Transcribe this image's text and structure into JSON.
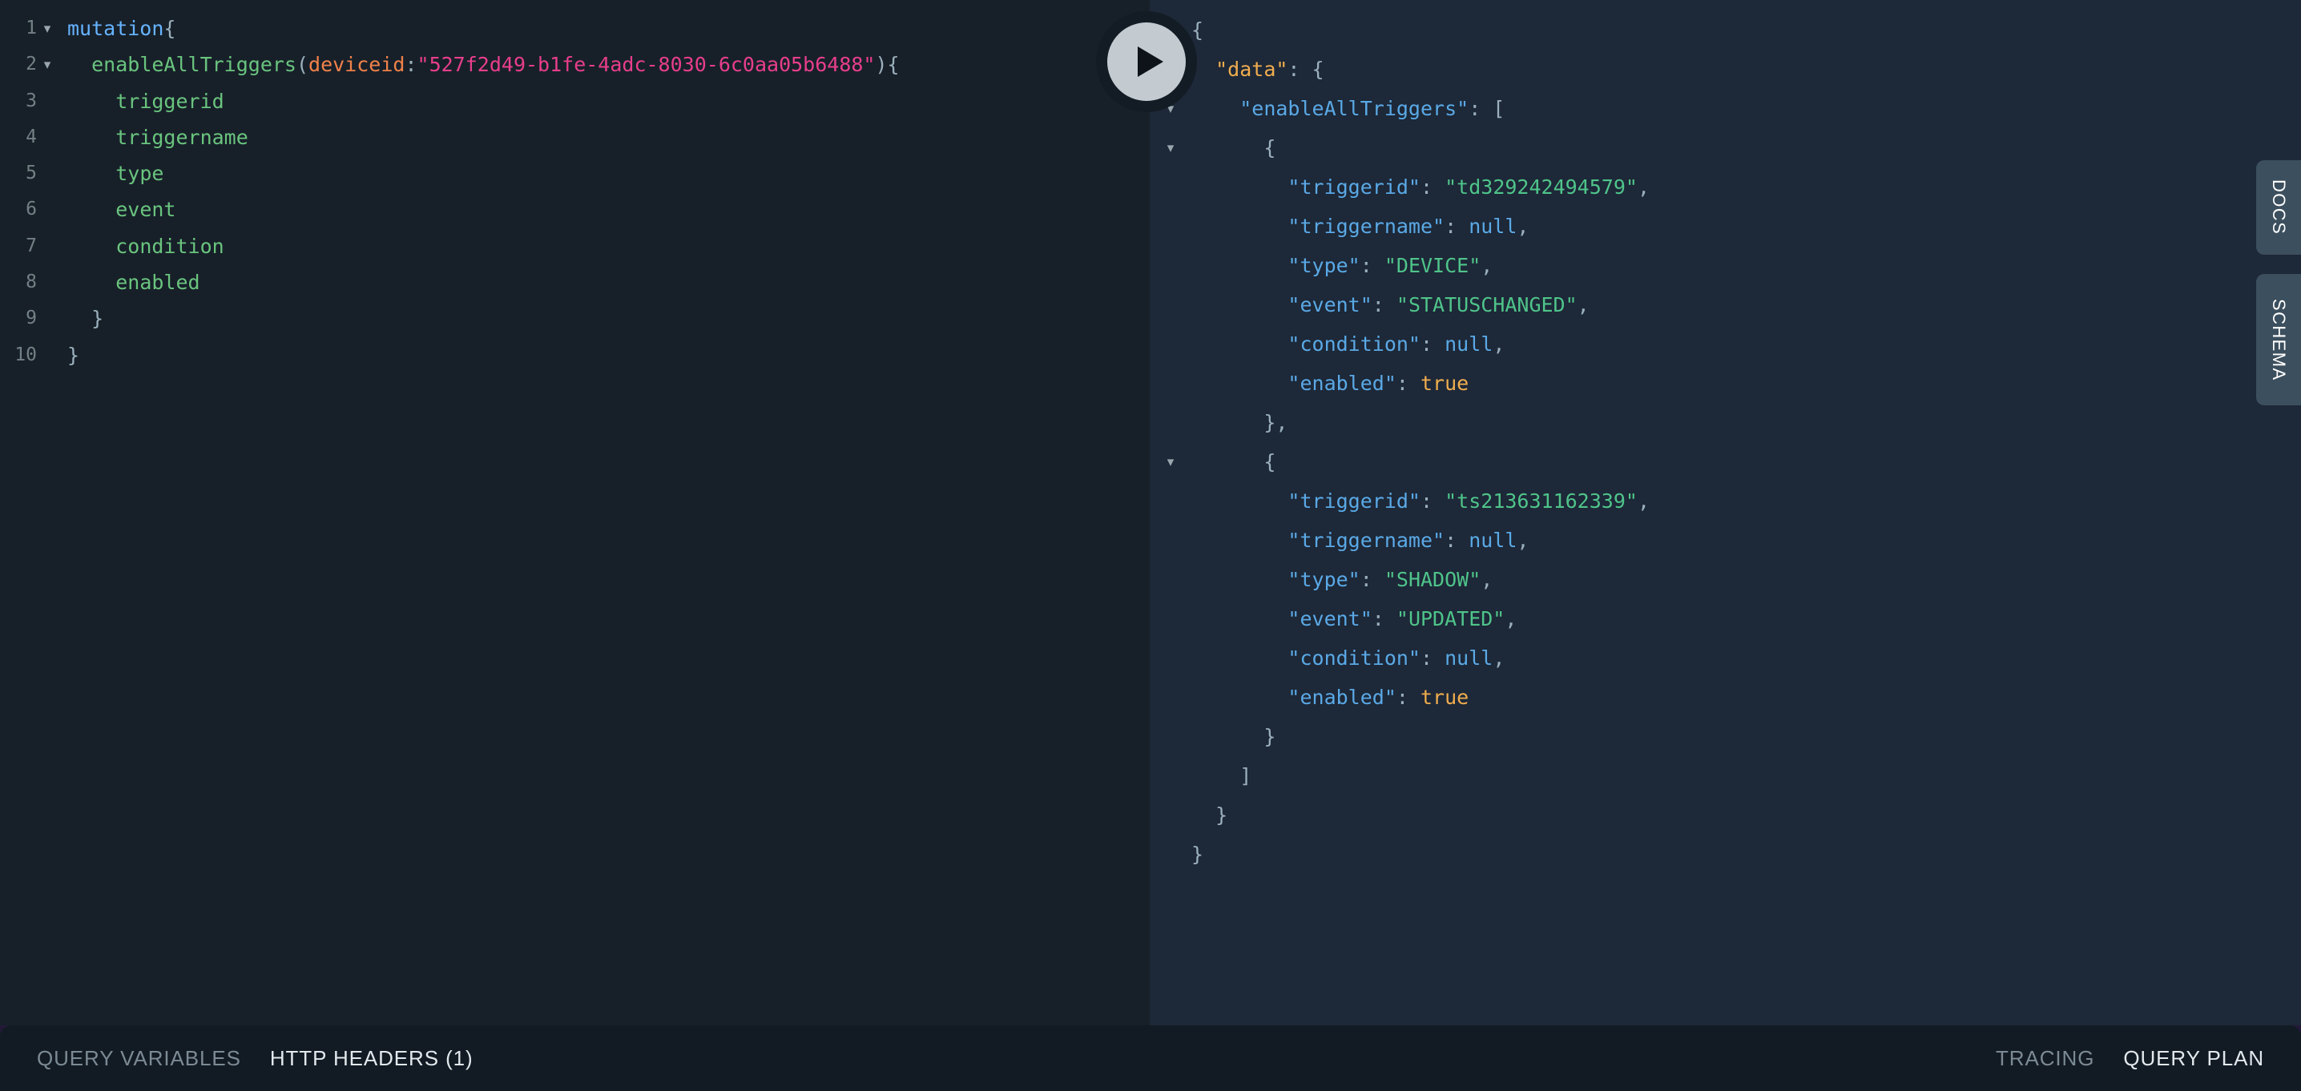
{
  "editor": {
    "device_id": "527f2d49-b1fe-4adc-8030-6c0aa05b6488",
    "lines": [
      {
        "num": "1",
        "fold": "▾",
        "html": "kw:mutation|punct:{"
      },
      {
        "num": "2",
        "fold": "▾",
        "html": "sp:2|field:enableAllTriggers|punct:(|arg:deviceid|punct::|str:\"527f2d49-b1fe-4adc-8030-6c0aa05b6488\"|punct:)|punct:{"
      },
      {
        "num": "3",
        "fold": "",
        "html": "sp:4|field:triggerid"
      },
      {
        "num": "4",
        "fold": "",
        "html": "sp:4|field:triggername"
      },
      {
        "num": "5",
        "fold": "",
        "html": "sp:4|field:type"
      },
      {
        "num": "6",
        "fold": "",
        "html": "sp:4|field:event"
      },
      {
        "num": "7",
        "fold": "",
        "html": "sp:4|field:condition"
      },
      {
        "num": "8",
        "fold": "",
        "html": "sp:4|field:enabled"
      },
      {
        "num": "9",
        "fold": "",
        "html": "sp:2|punct:}"
      },
      {
        "num": "10",
        "fold": "",
        "html": "punct:}"
      }
    ],
    "text": "mutation{\n  enableAllTriggers(deviceid:\"527f2d49-b1fe-4adc-8030-6c0aa05b6488\"){\n    triggerid\n    triggername\n    type\n    event\n    condition\n    enabled\n  }\n}"
  },
  "result": {
    "rows": [
      {
        "fold": "▾",
        "indent": 0,
        "tokens": [
          {
            "t": "punct",
            "v": "{"
          }
        ]
      },
      {
        "fold": "▾",
        "indent": 1,
        "tokens": [
          {
            "t": "key-d",
            "v": "\"data\""
          },
          {
            "t": "punct",
            "v": ": {"
          }
        ]
      },
      {
        "fold": "▾",
        "indent": 2,
        "tokens": [
          {
            "t": "key",
            "v": "\"enableAllTriggers\""
          },
          {
            "t": "punct",
            "v": ": ["
          }
        ]
      },
      {
        "fold": "▾",
        "indent": 3,
        "tokens": [
          {
            "t": "punct",
            "v": "{"
          }
        ]
      },
      {
        "fold": "",
        "indent": 4,
        "tokens": [
          {
            "t": "key",
            "v": "\"triggerid\""
          },
          {
            "t": "punct",
            "v": ": "
          },
          {
            "t": "str",
            "v": "\"td329242494579\""
          },
          {
            "t": "punct",
            "v": ","
          }
        ]
      },
      {
        "fold": "",
        "indent": 4,
        "tokens": [
          {
            "t": "key",
            "v": "\"triggername\""
          },
          {
            "t": "punct",
            "v": ": "
          },
          {
            "t": "null",
            "v": "null"
          },
          {
            "t": "punct",
            "v": ","
          }
        ]
      },
      {
        "fold": "",
        "indent": 4,
        "tokens": [
          {
            "t": "key",
            "v": "\"type\""
          },
          {
            "t": "punct",
            "v": ": "
          },
          {
            "t": "str",
            "v": "\"DEVICE\""
          },
          {
            "t": "punct",
            "v": ","
          }
        ]
      },
      {
        "fold": "",
        "indent": 4,
        "tokens": [
          {
            "t": "key",
            "v": "\"event\""
          },
          {
            "t": "punct",
            "v": ": "
          },
          {
            "t": "str",
            "v": "\"STATUSCHANGED\""
          },
          {
            "t": "punct",
            "v": ","
          }
        ]
      },
      {
        "fold": "",
        "indent": 4,
        "tokens": [
          {
            "t": "key",
            "v": "\"condition\""
          },
          {
            "t": "punct",
            "v": ": "
          },
          {
            "t": "null",
            "v": "null"
          },
          {
            "t": "punct",
            "v": ","
          }
        ]
      },
      {
        "fold": "",
        "indent": 4,
        "tokens": [
          {
            "t": "key",
            "v": "\"enabled\""
          },
          {
            "t": "punct",
            "v": ": "
          },
          {
            "t": "bool",
            "v": "true"
          }
        ]
      },
      {
        "fold": "",
        "indent": 3,
        "tokens": [
          {
            "t": "punct",
            "v": "},"
          }
        ]
      },
      {
        "fold": "▾",
        "indent": 3,
        "tokens": [
          {
            "t": "punct",
            "v": "{"
          }
        ]
      },
      {
        "fold": "",
        "indent": 4,
        "tokens": [
          {
            "t": "key",
            "v": "\"triggerid\""
          },
          {
            "t": "punct",
            "v": ": "
          },
          {
            "t": "str",
            "v": "\"ts213631162339\""
          },
          {
            "t": "punct",
            "v": ","
          }
        ]
      },
      {
        "fold": "",
        "indent": 4,
        "tokens": [
          {
            "t": "key",
            "v": "\"triggername\""
          },
          {
            "t": "punct",
            "v": ": "
          },
          {
            "t": "null",
            "v": "null"
          },
          {
            "t": "punct",
            "v": ","
          }
        ]
      },
      {
        "fold": "",
        "indent": 4,
        "tokens": [
          {
            "t": "key",
            "v": "\"type\""
          },
          {
            "t": "punct",
            "v": ": "
          },
          {
            "t": "str",
            "v": "\"SHADOW\""
          },
          {
            "t": "punct",
            "v": ","
          }
        ]
      },
      {
        "fold": "",
        "indent": 4,
        "tokens": [
          {
            "t": "key",
            "v": "\"event\""
          },
          {
            "t": "punct",
            "v": ": "
          },
          {
            "t": "str",
            "v": "\"UPDATED\""
          },
          {
            "t": "punct",
            "v": ","
          }
        ]
      },
      {
        "fold": "",
        "indent": 4,
        "tokens": [
          {
            "t": "key",
            "v": "\"condition\""
          },
          {
            "t": "punct",
            "v": ": "
          },
          {
            "t": "null",
            "v": "null"
          },
          {
            "t": "punct",
            "v": ","
          }
        ]
      },
      {
        "fold": "",
        "indent": 4,
        "tokens": [
          {
            "t": "key",
            "v": "\"enabled\""
          },
          {
            "t": "punct",
            "v": ": "
          },
          {
            "t": "bool",
            "v": "true"
          }
        ]
      },
      {
        "fold": "",
        "indent": 3,
        "tokens": [
          {
            "t": "punct",
            "v": "}"
          }
        ]
      },
      {
        "fold": "",
        "indent": 2,
        "tokens": [
          {
            "t": "punct",
            "v": "]"
          }
        ]
      },
      {
        "fold": "",
        "indent": 1,
        "tokens": [
          {
            "t": "punct",
            "v": "}"
          }
        ]
      },
      {
        "fold": "",
        "indent": 0,
        "tokens": [
          {
            "t": "punct",
            "v": "}"
          }
        ]
      }
    ]
  },
  "execute": {
    "label": "play-button"
  },
  "side_tabs": {
    "docs": "DOCS",
    "schema": "SCHEMA"
  },
  "bottom_bar": {
    "left": [
      {
        "label": "QUERY VARIABLES",
        "active": false
      },
      {
        "label": "HTTP HEADERS (1)",
        "active": true
      }
    ],
    "right": [
      {
        "label": "TRACING",
        "active": false
      },
      {
        "label": "QUERY PLAN",
        "active": true
      }
    ]
  },
  "colors": {
    "editor_bg": "#172029",
    "result_bg": "#1d2838",
    "bottom_bar_bg": "#121b24",
    "page_accent": "#241838",
    "side_tab_bg": "#3c4f5e",
    "execute_ring": "#131c25",
    "execute_fill": "#c3cad0",
    "keyword": "#66b3ff",
    "field": "#6ac47e",
    "argument": "#f0814a",
    "string_gql": "#e83e8c",
    "json_key": "#5aa9e6",
    "json_key_data": "#f0ad4e",
    "json_string": "#4fc48a",
    "json_bool": "#f0ad4e",
    "punctuation": "#9bb0bd",
    "line_number": "#95a5a6",
    "bar_inactive": "#7c8a95",
    "bar_active": "#e2e8ec"
  }
}
